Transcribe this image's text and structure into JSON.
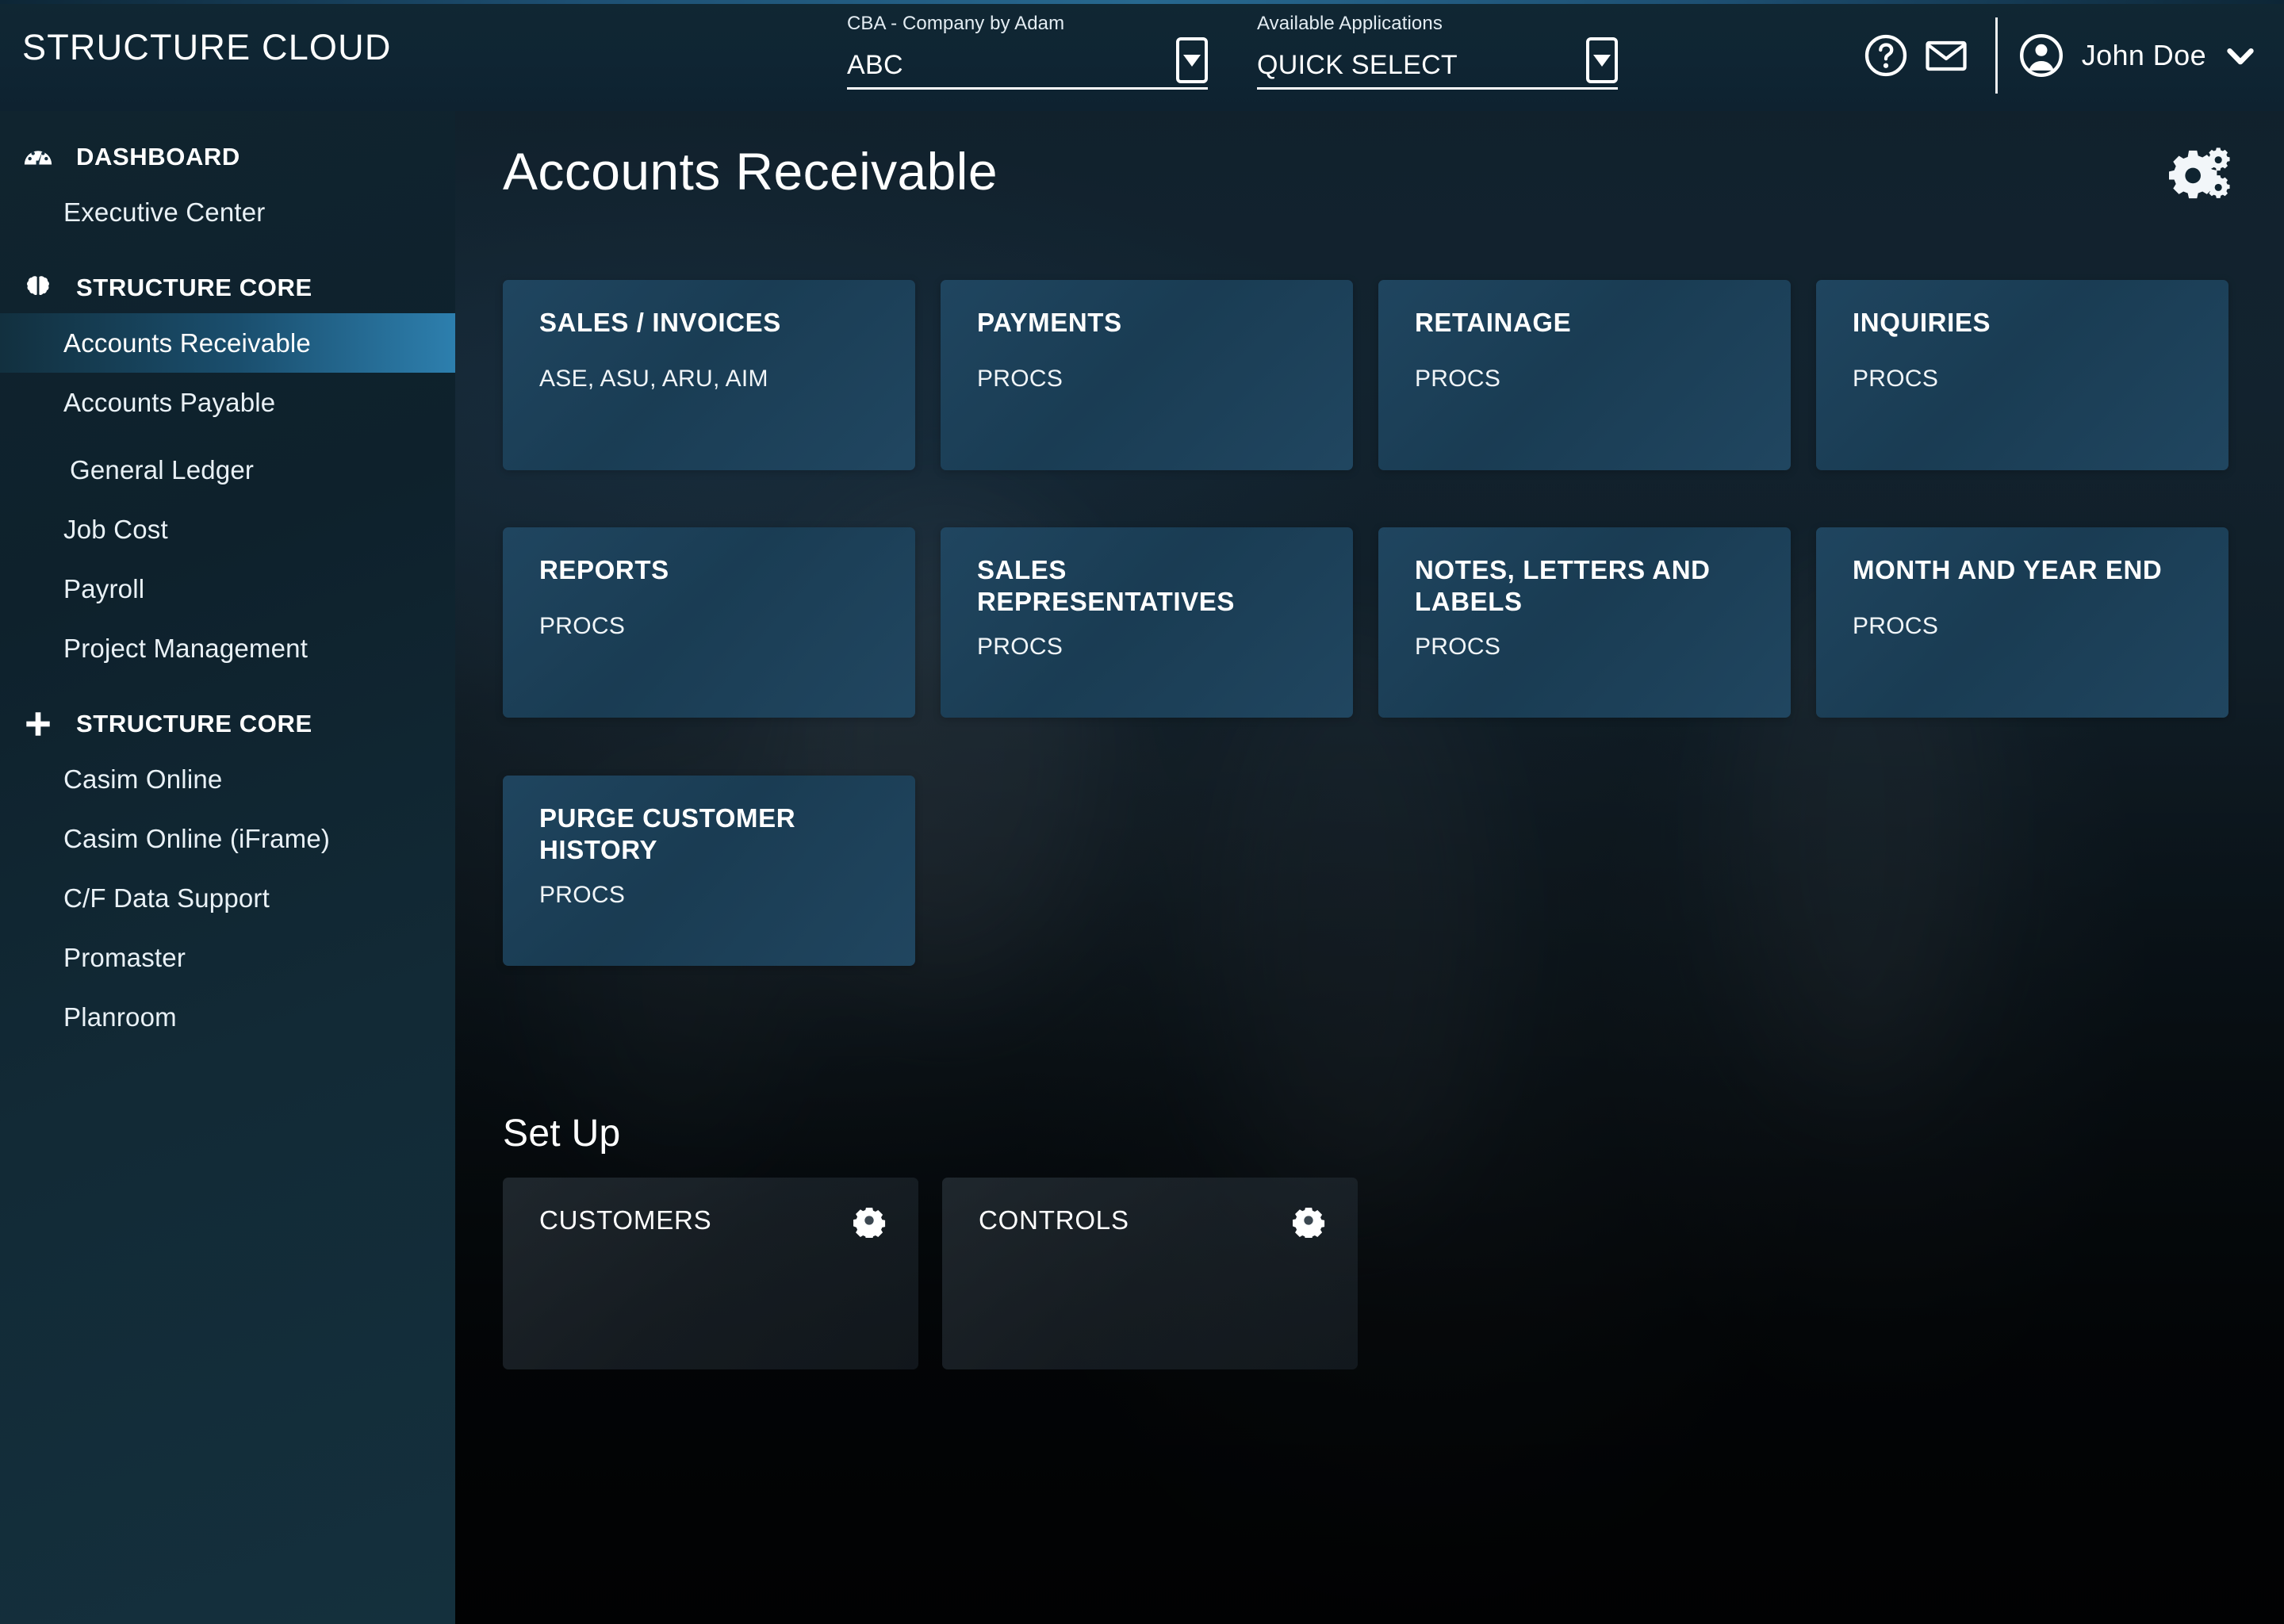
{
  "app": {
    "brand": "STRUCTURE CLOUD",
    "accent_color": "#2d7fae",
    "header_bg": "#0f2533",
    "tile_color": "#204762"
  },
  "header": {
    "company_select": {
      "label": "CBA - Company by Adam",
      "value": "ABC",
      "icon": "chevron-down-icon"
    },
    "apps_select": {
      "label": "Available Applications",
      "value": "QUICK SELECT",
      "icon": "chevron-down-icon"
    },
    "help_icon": "help-circle-icon",
    "mail_icon": "envelope-icon",
    "avatar_icon": "user-circle-icon",
    "user_name": "John Doe",
    "user_caret_icon": "chevron-down-icon"
  },
  "sidebar": {
    "groups": [
      {
        "title": "DASHBOARD",
        "icon": "gauge-icon",
        "items": [
          {
            "label": "Executive Center",
            "active": false
          }
        ]
      },
      {
        "title": "STRUCTURE CORE",
        "icon": "brain-icon",
        "items": [
          {
            "label": "Accounts Receivable",
            "active": true
          },
          {
            "label": "Accounts Payable",
            "active": false
          },
          {
            "label": "General Ledger",
            "active": false
          },
          {
            "label": "Job Cost",
            "active": false
          },
          {
            "label": "Payroll",
            "active": false
          },
          {
            "label": "Project Management",
            "active": false
          }
        ]
      },
      {
        "title": "STRUCTURE CORE",
        "icon": "plus-icon",
        "items": [
          {
            "label": "Casim Online",
            "active": false
          },
          {
            "label": "Casim Online (iFrame)",
            "active": false
          },
          {
            "label": "C/F Data Support",
            "active": false
          },
          {
            "label": "Promaster",
            "active": false
          },
          {
            "label": "Planroom",
            "active": false
          }
        ]
      }
    ]
  },
  "main": {
    "page_title": "Accounts Receivable",
    "settings_icon": "gears-icon",
    "tiles": [
      {
        "title": "SALES / INVOICES",
        "subtitle": "ASE, ASU, ARU, AIM"
      },
      {
        "title": "PAYMENTS",
        "subtitle": "PROCS"
      },
      {
        "title": "RETAINAGE",
        "subtitle": "PROCS"
      },
      {
        "title": "INQUIRIES",
        "subtitle": "PROCS"
      },
      {
        "title": "REPORTS",
        "subtitle": "PROCS"
      },
      {
        "title": "SALES REPRESENTATIVES",
        "subtitle": "PROCS"
      },
      {
        "title": "NOTES, LETTERS AND LABELS",
        "subtitle": "PROCS"
      },
      {
        "title": "MONTH AND YEAR END",
        "subtitle": "PROCS"
      },
      {
        "title": "PURGE CUSTOMER HISTORY",
        "subtitle": "PROCS"
      }
    ],
    "setup_section": {
      "heading": "Set Up",
      "tiles": [
        {
          "title": "CUSTOMERS",
          "icon": "gear-icon"
        },
        {
          "title": "CONTROLS",
          "icon": "gear-icon"
        }
      ]
    }
  }
}
